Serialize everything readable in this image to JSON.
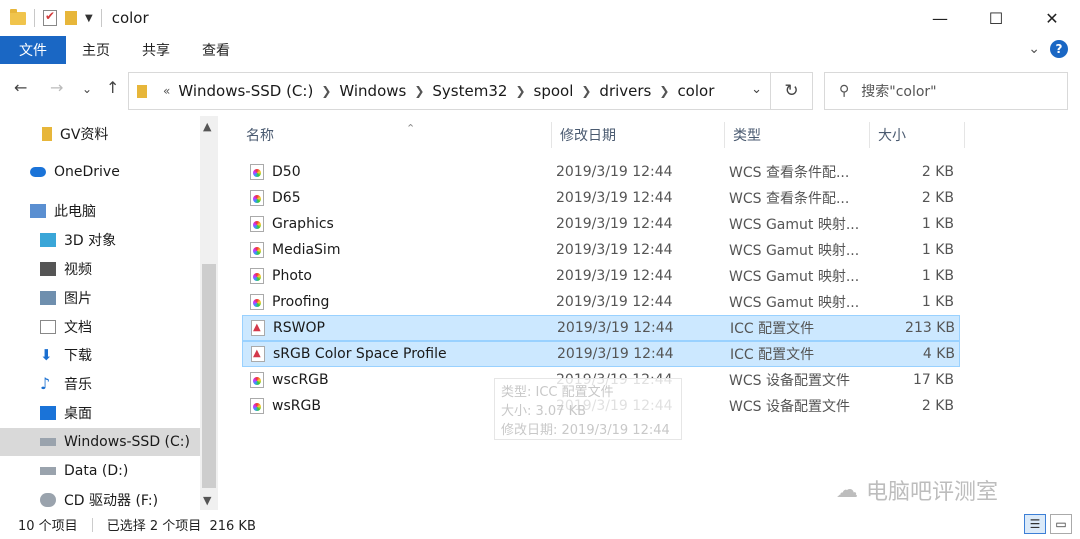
{
  "window": {
    "title": "color",
    "controls": [
      "—",
      "☐",
      "✕"
    ]
  },
  "ribbon": {
    "tabs": [
      "文件",
      "主页",
      "共享",
      "查看"
    ]
  },
  "nav": {
    "breadcrumb": [
      "Windows-SSD (C:)",
      "Windows",
      "System32",
      "spool",
      "drivers",
      "color"
    ],
    "search_placeholder": "搜索\"color\""
  },
  "sidebar": {
    "items": [
      {
        "label": "GV资料",
        "icon": "folder-icon"
      },
      {
        "label": "OneDrive",
        "icon": "cloud-icon"
      },
      {
        "label": "此电脑",
        "icon": "pc-icon"
      },
      {
        "label": "3D 对象",
        "icon": "cube-icon"
      },
      {
        "label": "视频",
        "icon": "video-icon"
      },
      {
        "label": "图片",
        "icon": "picture-icon"
      },
      {
        "label": "文档",
        "icon": "document-icon"
      },
      {
        "label": "下载",
        "icon": "download-icon"
      },
      {
        "label": "音乐",
        "icon": "music-icon"
      },
      {
        "label": "桌面",
        "icon": "desktop-icon"
      },
      {
        "label": "Windows-SSD (C:)",
        "icon": "drive-icon",
        "selected": true
      },
      {
        "label": "Data (D:)",
        "icon": "drive-icon"
      },
      {
        "label": "CD 驱动器 (F:)",
        "icon": "cd-icon"
      }
    ]
  },
  "columns": [
    "名称",
    "修改日期",
    "类型",
    "大小"
  ],
  "files": [
    {
      "name": "D50",
      "date": "2019/3/19 12:44",
      "type": "WCS 查看条件配...",
      "size": "2 KB",
      "icon": "wcs"
    },
    {
      "name": "D65",
      "date": "2019/3/19 12:44",
      "type": "WCS 查看条件配...",
      "size": "2 KB",
      "icon": "wcs"
    },
    {
      "name": "Graphics",
      "date": "2019/3/19 12:44",
      "type": "WCS Gamut 映射...",
      "size": "1 KB",
      "icon": "wcs"
    },
    {
      "name": "MediaSim",
      "date": "2019/3/19 12:44",
      "type": "WCS Gamut 映射...",
      "size": "1 KB",
      "icon": "wcs"
    },
    {
      "name": "Photo",
      "date": "2019/3/19 12:44",
      "type": "WCS Gamut 映射...",
      "size": "1 KB",
      "icon": "wcs"
    },
    {
      "name": "Proofing",
      "date": "2019/3/19 12:44",
      "type": "WCS Gamut 映射...",
      "size": "1 KB",
      "icon": "wcs"
    },
    {
      "name": "RSWOP",
      "date": "2019/3/19 12:44",
      "type": "ICC 配置文件",
      "size": "213 KB",
      "icon": "icc",
      "selected": true
    },
    {
      "name": "sRGB Color Space Profile",
      "date": "2019/3/19 12:44",
      "type": "ICC 配置文件",
      "size": "4 KB",
      "icon": "icc",
      "selected": true
    },
    {
      "name": "wscRGB",
      "date": "2019/3/19 12:44",
      "type": "WCS 设备配置文件",
      "size": "17 KB",
      "icon": "wcs"
    },
    {
      "name": "wsRGB",
      "date": "2019/3/19 12:44",
      "type": "WCS 设备配置文件",
      "size": "2 KB",
      "icon": "wcs"
    }
  ],
  "tooltip": {
    "line1": "类型: ICC 配置文件",
    "line2": "大小: 3.07 KB",
    "line3": "修改日期: 2019/3/19 12:44"
  },
  "status": {
    "count": "10 个项目",
    "selection": "已选择 2 个项目  216 KB"
  },
  "watermark": "电脑吧评测室",
  "colors": {
    "accent": "#1a67c4",
    "selection": "#cce8ff"
  }
}
